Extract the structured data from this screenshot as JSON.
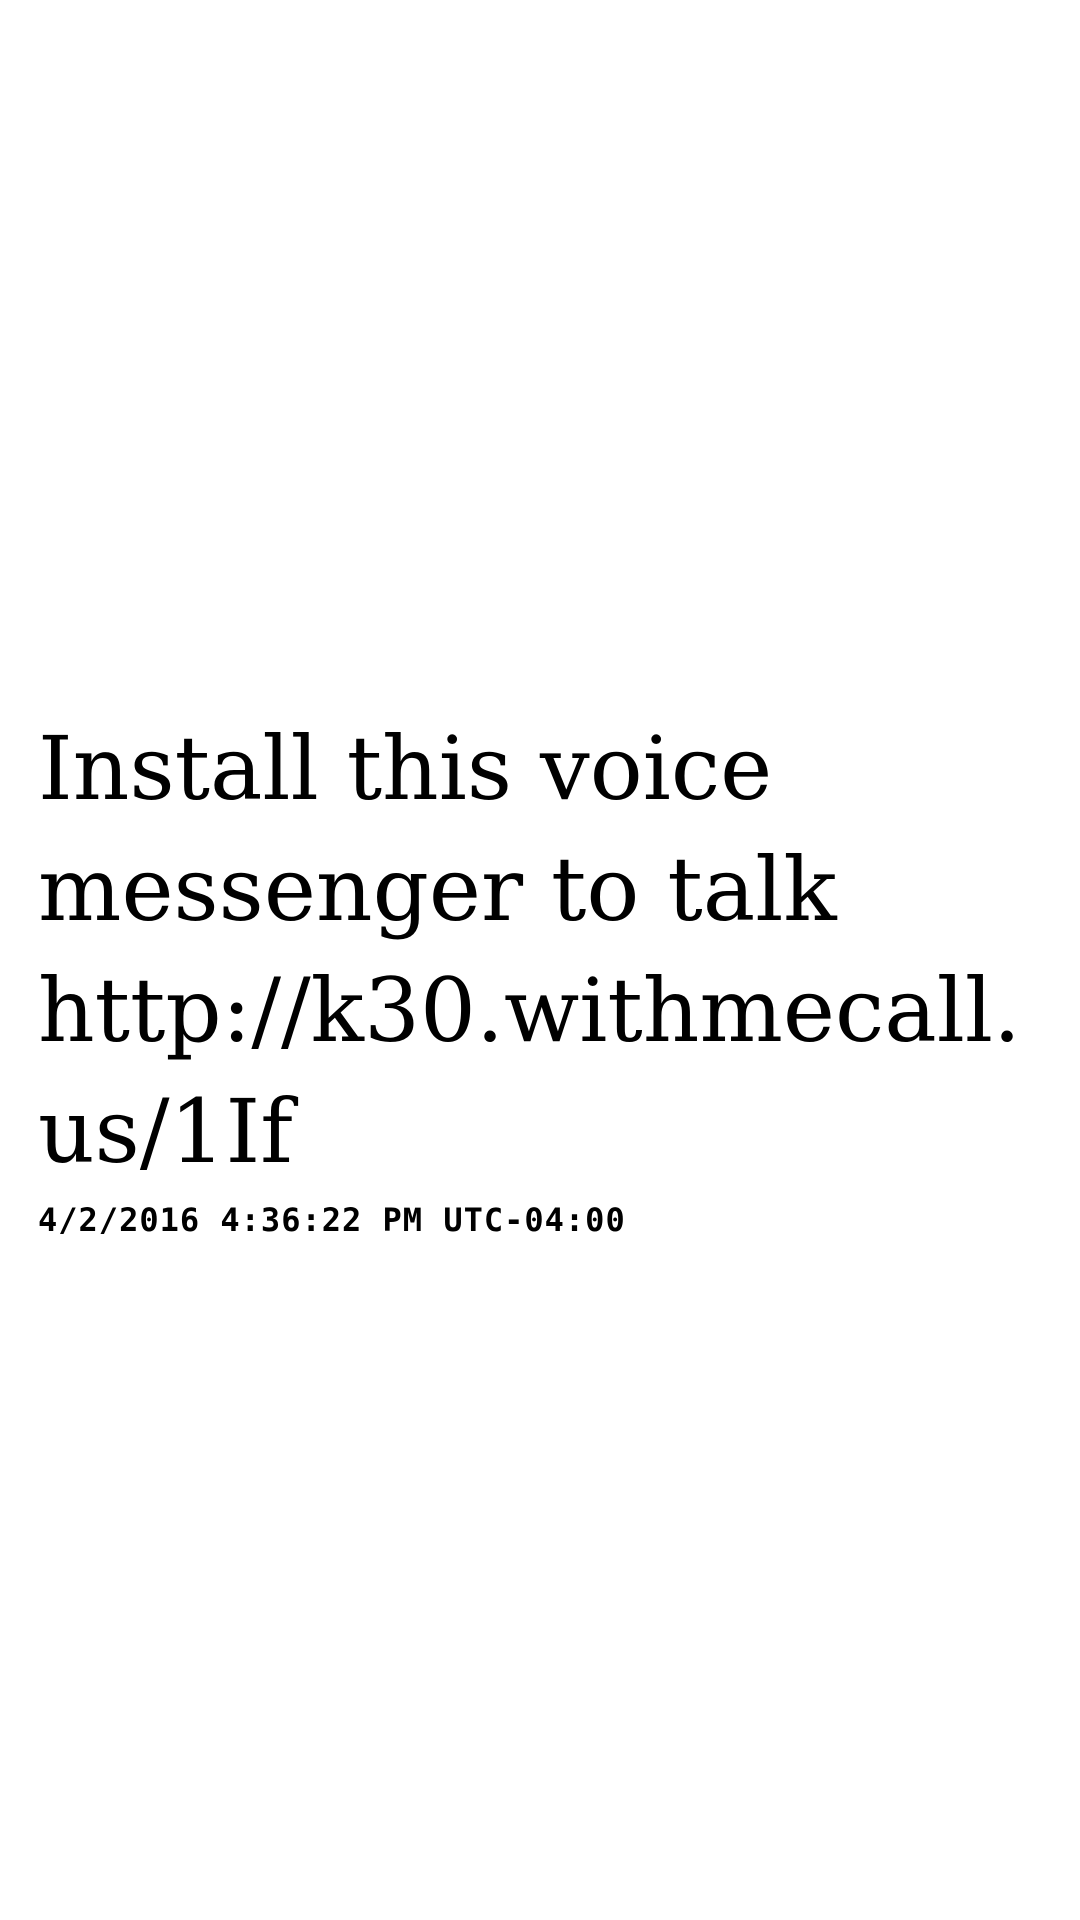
{
  "message": {
    "lines": [
      "Install this voice",
      "messenger to talk",
      "http://k30.withmecall.",
      "us/1If"
    ],
    "timestamp": "4/2/2016 4:36:22 PM UTC-04:00"
  },
  "colors": {
    "background": "#ffffff",
    "text": "#000000"
  }
}
